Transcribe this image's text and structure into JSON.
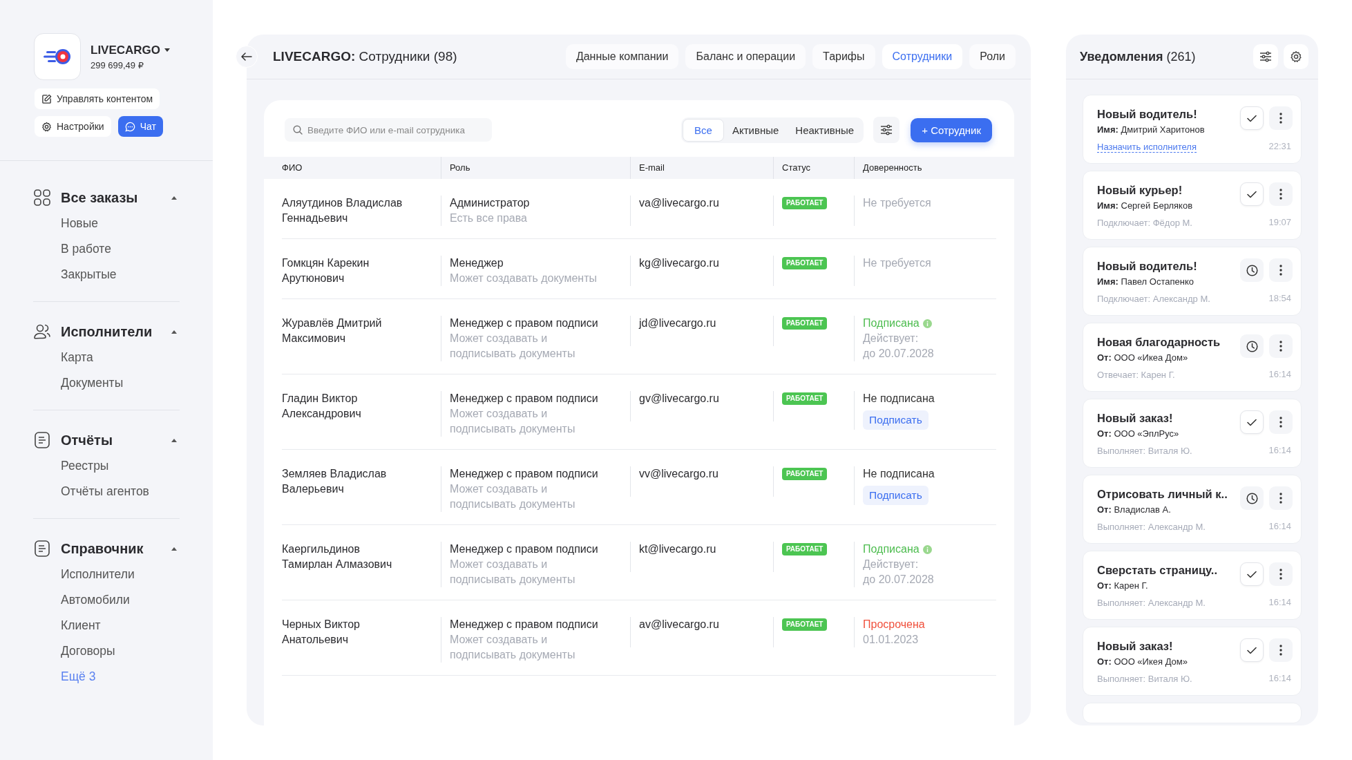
{
  "account": {
    "name": "LIVECARGO",
    "balance": "299 699,49 ₽",
    "buttons": [
      {
        "kind": "edit",
        "label": "Управлять контентом"
      },
      {
        "kind": "settings",
        "label": "Настройки"
      },
      {
        "kind": "chat",
        "label": "Чат"
      }
    ]
  },
  "nav": [
    {
      "label": "Все заказы",
      "expanded": true,
      "children": [
        {
          "label": "Новые",
          "kind": "item"
        },
        {
          "label": "В работе",
          "kind": "item"
        },
        {
          "label": "Закрытые",
          "kind": "item"
        }
      ]
    },
    {
      "label": "Исполнители",
      "expanded": true,
      "children": [
        {
          "label": "Карта",
          "kind": "item"
        },
        {
          "label": "Документы",
          "kind": "item"
        }
      ]
    },
    {
      "label": "Отчёты",
      "expanded": true,
      "children": [
        {
          "label": "Реестры",
          "kind": "item"
        },
        {
          "label": "Отчёты агентов",
          "kind": "item"
        }
      ]
    },
    {
      "label": "Справочник",
      "expanded": true,
      "children": [
        {
          "label": "Исполнители",
          "kind": "item"
        },
        {
          "label": "Автомобили",
          "kind": "item"
        },
        {
          "label": "Клиент",
          "kind": "item"
        },
        {
          "label": "Договоры",
          "kind": "item"
        },
        {
          "label": "Ещё 3",
          "kind": "link"
        }
      ]
    }
  ],
  "page": {
    "title": "**LIVECARGO:** Сотрудники (98)",
    "tabs": [
      {
        "label": "Данные компании",
        "selected": false
      },
      {
        "label": "Баланс и операции",
        "selected": false
      },
      {
        "label": "Тарифы",
        "selected": false
      },
      {
        "label": "Сотрудники",
        "selected": true
      },
      {
        "label": "Роли",
        "selected": false
      }
    ]
  },
  "toolbar": {
    "search": {
      "placeholder": "Введите ФИО или e-mail сотрудника"
    },
    "filters": [
      {
        "label": "Все",
        "selected": true
      },
      {
        "label": "Активные",
        "selected": false
      },
      {
        "label": "Неактивные",
        "selected": false
      }
    ],
    "add_button": "+ Сотрудник"
  },
  "table": {
    "columns": [
      "ФИО",
      "Роль",
      "E-mail",
      "Статус",
      "Доверенность"
    ],
    "rows": [
      {
        "name": "Аляутдинов Владислав Геннадьевич",
        "role": "Администратор",
        "role_desc": "Есть все права",
        "email": "va@livecargo.ru",
        "status": "РАБОТАЕТ",
        "proxy": {
          "kind": "not_required",
          "text": "Не требуется"
        }
      },
      {
        "name": "Гомкцян Карекин Арутюнович",
        "role": "Менеджер",
        "role_desc": "Может создавать документы",
        "email": "kg@livecargo.ru",
        "status": "РАБОТАЕТ",
        "proxy": {
          "kind": "not_required",
          "text": "Не требуется"
        }
      },
      {
        "name": "Журавлёв Дмитрий Максимович",
        "role": "Менеджер с правом подписи",
        "role_desc": "Может создавать и подписывать документы",
        "email": "jd@livecargo.ru",
        "status": "РАБОТАЕТ",
        "proxy": {
          "kind": "signed",
          "text": "Подписана",
          "details": [
            "Действует:",
            "до 20.07.2028"
          ]
        }
      },
      {
        "name": "Гладин Виктор Александрович",
        "role": "Менеджер с правом подписи",
        "role_desc": "Может создавать и подписывать документы",
        "email": "gv@livecargo.ru",
        "status": "РАБОТАЕТ",
        "proxy": {
          "kind": "unsigned",
          "text": "Не подписана",
          "button": "Подписать"
        }
      },
      {
        "name": "Земляев Владислав Валерьевич",
        "role": "Менеджер с правом подписи",
        "role_desc": "Может создавать и подписывать документы",
        "email": "vv@livecargo.ru",
        "status": "РАБОТАЕТ",
        "proxy": {
          "kind": "unsigned",
          "text": "Не подписана",
          "button": "Подписать"
        }
      },
      {
        "name": "Каергильдинов Тамирлан Алмазович",
        "role": "Менеджер с правом подписи",
        "role_desc": "Может создавать и подписывать документы",
        "email": "kt@livecargo.ru",
        "status": "РАБОТАЕТ",
        "proxy": {
          "kind": "signed",
          "text": "Подписана",
          "details": [
            "Действует:",
            "до 20.07.2028"
          ]
        }
      },
      {
        "name": "Черных Виктор Анатольевич",
        "role": "Менеджер с правом подписи",
        "role_desc": "Может создавать и подписывать документы",
        "email": "av@livecargo.ru",
        "status": "РАБОТАЕТ",
        "proxy": {
          "kind": "expired",
          "text": "Просрочена",
          "details": [
            "01.01.2023"
          ]
        }
      }
    ]
  },
  "notifications": {
    "title": "**Уведомления** (261)",
    "items": [
      {
        "title": "Новый водитель!",
        "subtitle": "**Имя:** Дмитрий Харитонов",
        "footer": "Назначить исполнителя",
        "footer_link": true,
        "time": "22:31",
        "kind": "check"
      },
      {
        "title": "Новый курьер!",
        "subtitle": "**Имя:** Сергей Берляков",
        "footer": "Подключает: Фёдор М.",
        "footer_link": false,
        "time": "19:07",
        "kind": "check"
      },
      {
        "title": "Новый водитель!",
        "subtitle": "**Имя:** Павел Остапенко",
        "footer": "Подключает: Александр М.",
        "footer_link": false,
        "time": "18:54",
        "kind": "clock"
      },
      {
        "title": "Новая благодарность",
        "subtitle": "**От:** ООО «Икеа Дом»",
        "footer": "Отвечает: Карен Г.",
        "footer_link": false,
        "time": "16:14",
        "kind": "clock"
      },
      {
        "title": "Новый заказ!",
        "subtitle": "**От:** ООО «ЭплРус»",
        "footer": "Выполняет: Виталя Ю.",
        "footer_link": false,
        "time": "16:14",
        "kind": "check"
      },
      {
        "title": "Отрисовать личный к..",
        "subtitle": "**От:** Владислав А.",
        "footer": "Выполняет: Александр М.",
        "footer_link": false,
        "time": "16:14",
        "kind": "clock"
      },
      {
        "title": "Сверстать страницу..",
        "subtitle": "**От:** Карен Г.",
        "footer": "Выполняет: Александр М.",
        "footer_link": false,
        "time": "16:14",
        "kind": "check"
      },
      {
        "title": "Новый заказ!",
        "subtitle": "**От:** ООО «Икея Дом»",
        "footer": "Выполняет: Виталя Ю.",
        "footer_link": false,
        "time": "16:14",
        "kind": "check"
      }
    ]
  }
}
